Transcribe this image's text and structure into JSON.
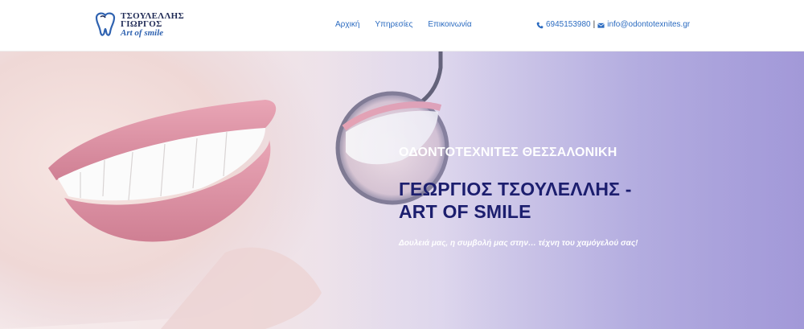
{
  "brand": {
    "name_line1": "ΤΣΟΥΛΕΛΛΗΣ",
    "name_line2": "ΓΙΩΡΓΟΣ",
    "slogan": "Art of smile"
  },
  "nav": {
    "items": [
      {
        "label": "Αρχική"
      },
      {
        "label": "Υπηρεσίες"
      },
      {
        "label": "Επικοινωνία"
      }
    ]
  },
  "contact": {
    "phone": "6945153980",
    "separator": "|",
    "email": "info@odontotexnites.gr"
  },
  "hero": {
    "subtitle": "ΟΔΟΝΤΟΤΕΧΝΙΤΕΣ ΘΕΣΣΑΛΟΝΙΚΗ",
    "title": "ΓΕΩΡΓΙΟΣ ΤΣΟΥΛΕΛΛΗΣ - ART OF SMILE",
    "tagline": "Δουλειά μας, η συμβολή μας στην… τέχνη του χαμόγελού σας!"
  },
  "colors": {
    "link": "#2b6bc0",
    "title": "#1c1e6e",
    "logo": "#1f2a55"
  },
  "icons": [
    "tooth-logo-icon",
    "phone-icon",
    "envelope-icon"
  ]
}
